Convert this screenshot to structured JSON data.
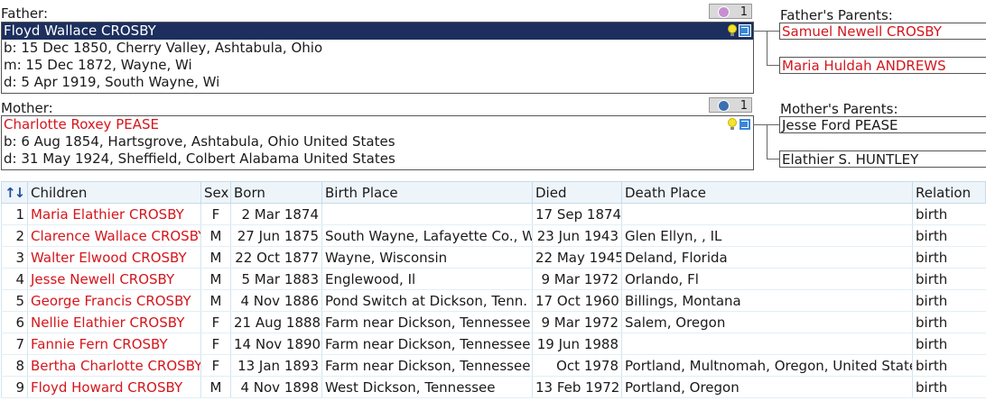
{
  "father": {
    "label": "Father:",
    "count": "1",
    "name": "Floyd Wallace CROSBY",
    "lines": [
      "b: 15 Dec 1850, Cherry Valley, Ashtabula, Ohio",
      "m: 15 Dec 1872, Wayne, Wi",
      "d: 5 Apr 1919, South Wayne, Wi"
    ]
  },
  "mother": {
    "label": "Mother:",
    "count": "1",
    "name": "Charlotte Roxey PEASE",
    "lines": [
      "b: 6 Aug 1854, Hartsgrove, Ashtabula, Ohio United States",
      "d: 31 May 1924, Sheffield, Colbert Alabama United States"
    ]
  },
  "fathers_parents": {
    "label": "Father's Parents:",
    "father": "Samuel Newell CROSBY",
    "mother": "Maria Huldah ANDREWS"
  },
  "mothers_parents": {
    "label": "Mother's Parents:",
    "father": "Jesse Ford PEASE",
    "mother": "Elathier S. HUNTLEY"
  },
  "colors": {
    "selected_bg": "#1c2f5e",
    "name_red": "#d4161c",
    "female_badge": "#c58fd2",
    "male_badge": "#3a6fb0"
  },
  "children_table": {
    "headers": [
      "Children",
      "Sex",
      "Born",
      "Birth Place",
      "Died",
      "Death Place",
      "Relation"
    ],
    "rows": [
      [
        "1",
        "Maria Elathier CROSBY",
        "F",
        "2 Mar 1874",
        "",
        "17 Sep 1874",
        "",
        "birth"
      ],
      [
        "2",
        "Clarence Wallace CROSBY",
        "M",
        "27 Jun 1875",
        "South Wayne, Lafayette Co., WI",
        "23 Jun 1943",
        "Glen Ellyn, , IL",
        "birth"
      ],
      [
        "3",
        "Walter Elwood CROSBY",
        "M",
        "22 Oct 1877",
        "Wayne, Wisconsin",
        "22 May 1945",
        "Deland, Florida",
        "birth"
      ],
      [
        "4",
        "Jesse Newell CROSBY",
        "M",
        "5 Mar 1883",
        "Englewood, Il",
        "9 Mar 1972",
        "Orlando, Fl",
        "birth"
      ],
      [
        "5",
        "George Francis CROSBY",
        "M",
        "4 Nov 1886",
        "Pond Switch at Dickson, Tenn.",
        "17 Oct 1960",
        "Billings, Montana",
        "birth"
      ],
      [
        "6",
        "Nellie Elathier CROSBY",
        "F",
        "21 Aug 1888",
        "Farm near Dickson, Tennessee",
        "9 Mar 1972",
        "Salem, Oregon",
        "birth"
      ],
      [
        "7",
        "Fannie Fern CROSBY",
        "F",
        "14 Nov 1890",
        "Farm near Dickson, Tennessee",
        "19 Jun 1988",
        "",
        "birth"
      ],
      [
        "8",
        "Bertha Charlotte CROSBY",
        "F",
        "13 Jan 1893",
        "Farm near Dickson, Tennessee",
        "Oct 1978",
        "Portland, Multnomah, Oregon, United States",
        "birth"
      ],
      [
        "9",
        "Floyd Howard CROSBY",
        "M",
        "4 Nov 1898",
        "West Dickson, Tennessee",
        "13 Feb 1972",
        "Portland, Oregon",
        "birth"
      ]
    ]
  }
}
